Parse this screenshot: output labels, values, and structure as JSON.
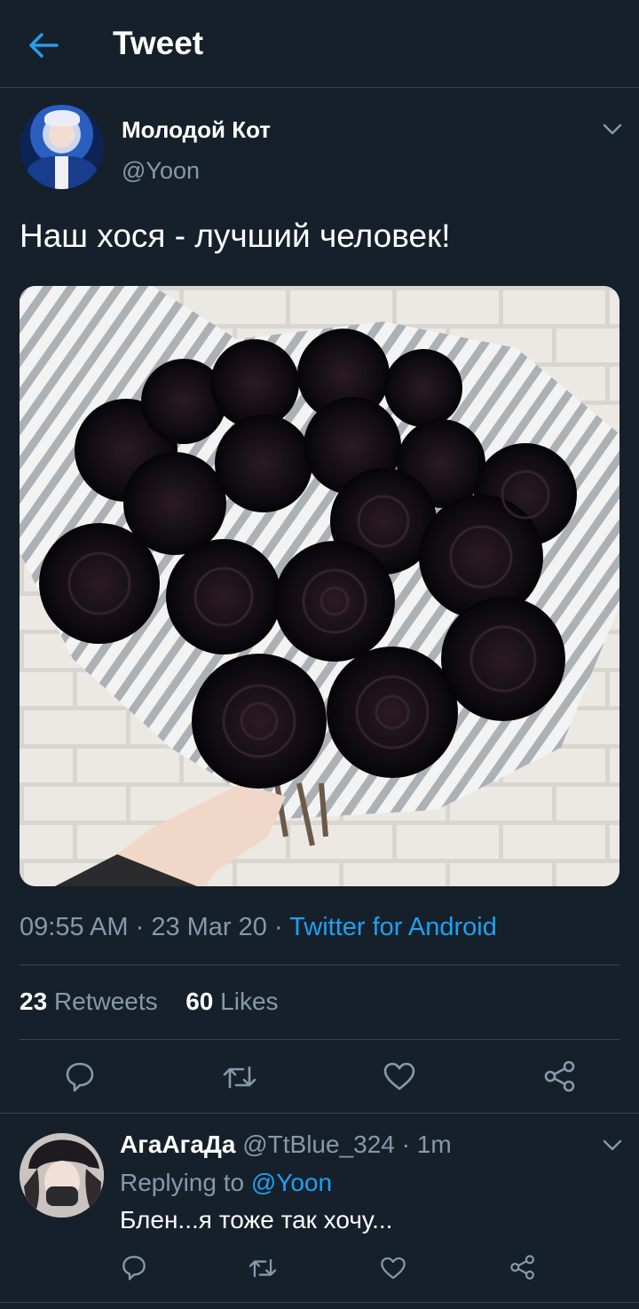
{
  "header": {
    "title": "Tweet",
    "back_icon": "arrow-left-icon"
  },
  "tweet": {
    "author_name": "Молодой Кот",
    "author_handle": "@Yoon",
    "text": "Наш хося - лучший человек!",
    "time": "09:55 AM",
    "date": "23 Mar 20",
    "source": "Twitter for Android",
    "retweets_count": "23",
    "retweets_label": "Retweets",
    "likes_count": "60",
    "likes_label": "Likes",
    "actions": [
      "reply-icon",
      "retweet-icon",
      "like-icon",
      "share-icon"
    ]
  },
  "reply": {
    "author_name": "АгаАгаДа",
    "author_handle": "@TtBlue_324",
    "time": "1m",
    "replying_label": "Replying to",
    "replying_to": "@Yoon",
    "text": "Блен...я тоже так хочу..."
  },
  "colors": {
    "background": "#15202b",
    "accent": "#1da1f2",
    "secondary_text": "#8899a6",
    "divider": "#38444d"
  }
}
